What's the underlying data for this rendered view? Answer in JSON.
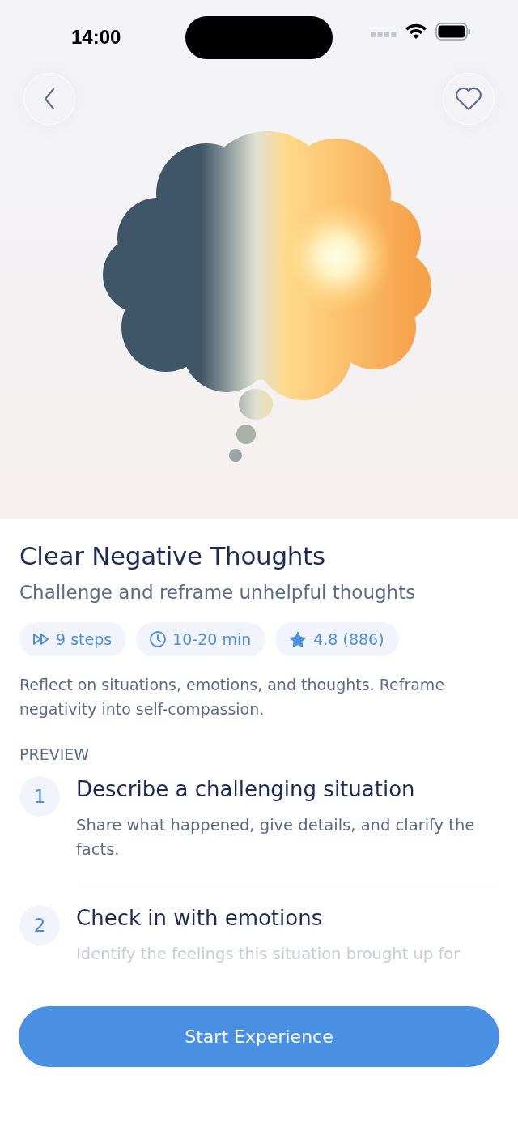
{
  "status_bar": {
    "time": "14:00"
  },
  "title": "Clear Negative Thoughts",
  "subtitle": "Challenge and reframe unhelpful thoughts",
  "chips": [
    {
      "kind": "steps",
      "label": "9 steps"
    },
    {
      "kind": "duration",
      "label": "10-20 min"
    },
    {
      "kind": "rating",
      "label": "4.8 (886)"
    }
  ],
  "description": "Reflect on situations, emotions, and thoughts. Reframe negativity into self-compassion.",
  "preview": {
    "heading": "PREVIEW",
    "steps": [
      {
        "number": "1",
        "title": "Describe a challenging situation",
        "text": "Share what happened, give details, and clarify the facts.",
        "faded": false
      },
      {
        "number": "2",
        "title": "Check in with emotions",
        "text": "Identify the feelings this situation brought up for",
        "faded": true
      }
    ]
  },
  "primary_button": "Start Experience"
}
